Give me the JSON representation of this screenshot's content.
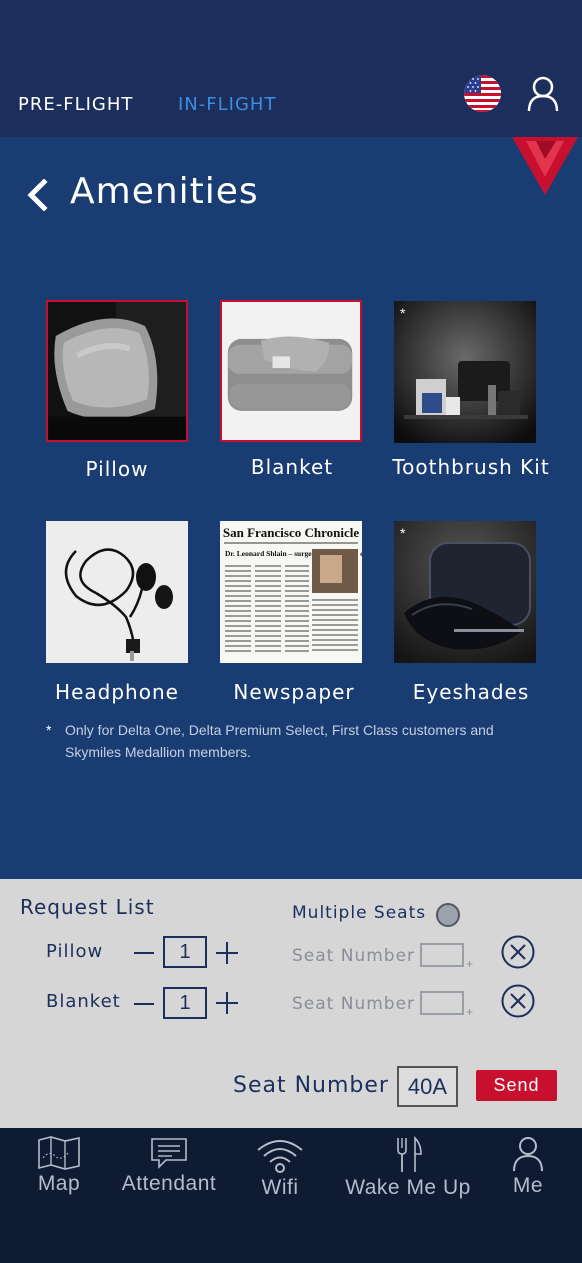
{
  "colors": {
    "navy": "#1c2f5c",
    "main_blue": "#193d72",
    "accent_blue": "#3d8de0",
    "delta_red": "#c8102e",
    "request_bg": "#d6d6d6",
    "tabbar_bg": "#0f1a33"
  },
  "nav": {
    "tabs": [
      {
        "label": "PRE-FLIGHT",
        "active": false
      },
      {
        "label": "IN-FLIGHT",
        "active": true
      }
    ],
    "language_icon": "us-flag-icon",
    "profile_icon": "user-icon"
  },
  "page": {
    "title": "Amenities",
    "back_icon": "chevron-left-icon"
  },
  "amenities": [
    {
      "label": "Pillow",
      "selected": true,
      "premium_only": false
    },
    {
      "label": "Blanket",
      "selected": true,
      "premium_only": false
    },
    {
      "label": "Toothbrush Kit",
      "selected": false,
      "premium_only": true,
      "marker": "*"
    },
    {
      "label": "Headphone",
      "selected": false,
      "premium_only": false
    },
    {
      "label": "Newspaper",
      "selected": false,
      "premium_only": false
    },
    {
      "label": "Eyeshades",
      "selected": false,
      "premium_only": true,
      "marker": "*"
    }
  ],
  "newspaper_thumb": {
    "masthead": "San Francisco Chronicle",
    "headline": "Dr. Leonard Shlain – surgeon and author, counted Gore, Björk as fans"
  },
  "footnote": {
    "marker": "*",
    "text": "Only for Delta One, Delta Premium Select, First Class customers and Skymiles Medallion members."
  },
  "request_list": {
    "title": "Request List",
    "multiple_seats_label": "Multiple Seats",
    "multiple_seats_checked": false,
    "items": [
      {
        "name": "Pillow",
        "quantity": "1",
        "seat_label": "Seat Number",
        "seat_plus": "+"
      },
      {
        "name": "Blanket",
        "quantity": "1",
        "seat_label": "Seat Number",
        "seat_plus": "+"
      }
    ],
    "seat_number_label": "Seat Number",
    "seat_number_value": "40A",
    "send_label": "Send"
  },
  "tabbar": [
    {
      "label": "Map",
      "icon": "map-icon"
    },
    {
      "label": "Attendant",
      "icon": "chat-icon"
    },
    {
      "label": "Wifi",
      "icon": "wifi-icon"
    },
    {
      "label": "Wake Me Up",
      "icon": "fork-knife-icon"
    },
    {
      "label": "Me",
      "icon": "user-icon"
    }
  ]
}
